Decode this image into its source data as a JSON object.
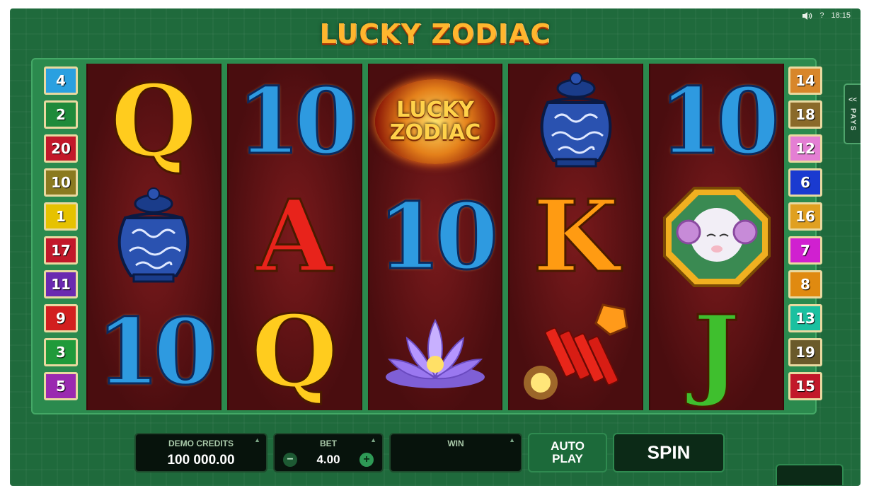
{
  "title": "LUCKY ZODIAC",
  "status": {
    "time": "18:15",
    "help": "?"
  },
  "pays_tab": {
    "arrows": "<<",
    "label": "PAYS"
  },
  "left_lines": [
    {
      "n": "4",
      "color": "#2aa0e0"
    },
    {
      "n": "2",
      "color": "#1f8a3a"
    },
    {
      "n": "20",
      "color": "#c2182a"
    },
    {
      "n": "10",
      "color": "#8a7a20"
    },
    {
      "n": "1",
      "color": "#e6c200"
    },
    {
      "n": "17",
      "color": "#c2182a"
    },
    {
      "n": "11",
      "color": "#6a2ab0"
    },
    {
      "n": "9",
      "color": "#d21f1f"
    },
    {
      "n": "3",
      "color": "#1f9a3a"
    },
    {
      "n": "5",
      "color": "#9a2ab0"
    }
  ],
  "right_lines": [
    {
      "n": "14",
      "color": "#d8862a"
    },
    {
      "n": "18",
      "color": "#8a6a2a"
    },
    {
      "n": "12",
      "color": "#e47fd4"
    },
    {
      "n": "6",
      "color": "#1a3ad0"
    },
    {
      "n": "16",
      "color": "#e0a020"
    },
    {
      "n": "7",
      "color": "#d020d0"
    },
    {
      "n": "8",
      "color": "#e08a10"
    },
    {
      "n": "13",
      "color": "#1ac0a0"
    },
    {
      "n": "19",
      "color": "#6a5a2a"
    },
    {
      "n": "15",
      "color": "#c2182a"
    }
  ],
  "reels": [
    [
      "Q",
      "vase",
      "10"
    ],
    [
      "10",
      "A",
      "Q"
    ],
    [
      "logo",
      "10",
      "lotus"
    ],
    [
      "vase",
      "K",
      "firecrackers"
    ],
    [
      "10",
      "ram",
      "J"
    ]
  ],
  "logo_symbol": {
    "line1": "LUCKY",
    "line2": "ZODIAC"
  },
  "controls": {
    "credits_label": "DEMO CREDITS",
    "credits_value": "100 000.00",
    "bet_label": "BET",
    "bet_value": "4.00",
    "bet_minus": "−",
    "bet_plus": "+",
    "win_label": "WIN",
    "win_value": "",
    "autoplay_line1": "AUTO",
    "autoplay_line2": "PLAY",
    "spin_label": "SPIN"
  }
}
